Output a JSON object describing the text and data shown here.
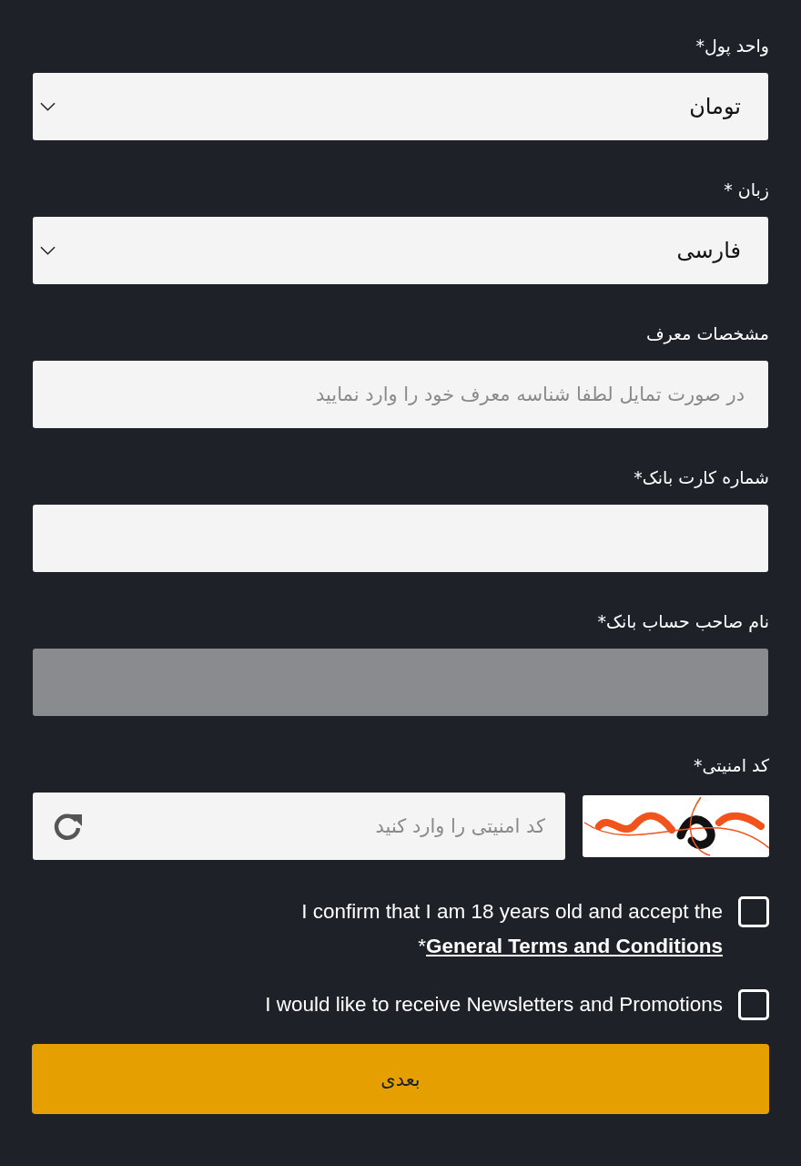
{
  "fields": [
    {
      "kind": "select",
      "label": "واحد پول*",
      "value": "تومان",
      "disabled": false
    },
    {
      "kind": "select",
      "label": "زبان *",
      "value": "فارسی",
      "disabled": false
    },
    {
      "kind": "text",
      "label": "مشخصات معرف",
      "placeholder": "در صورت تمایل لطفا شناسه معرف خود را وارد نمایید",
      "disabled": false
    },
    {
      "kind": "text",
      "label": "شماره کارت بانک*",
      "disabled": false
    },
    {
      "kind": "text",
      "label": "نام صاحب حساب بانک*",
      "disabled": true
    }
  ],
  "captcha": {
    "label": "کد امنیتی*",
    "placeholder": "کد امنیتی را وارد کنید"
  },
  "agreements": [
    {
      "text": "I confirm that I am 18 years old and accept the ",
      "link": "General Terms and Conditions",
      "suffix": "*",
      "checked": false
    },
    {
      "text": "I would like to receive Newsletters and Promotions",
      "checked": false
    }
  ],
  "next_button": "بعدی"
}
